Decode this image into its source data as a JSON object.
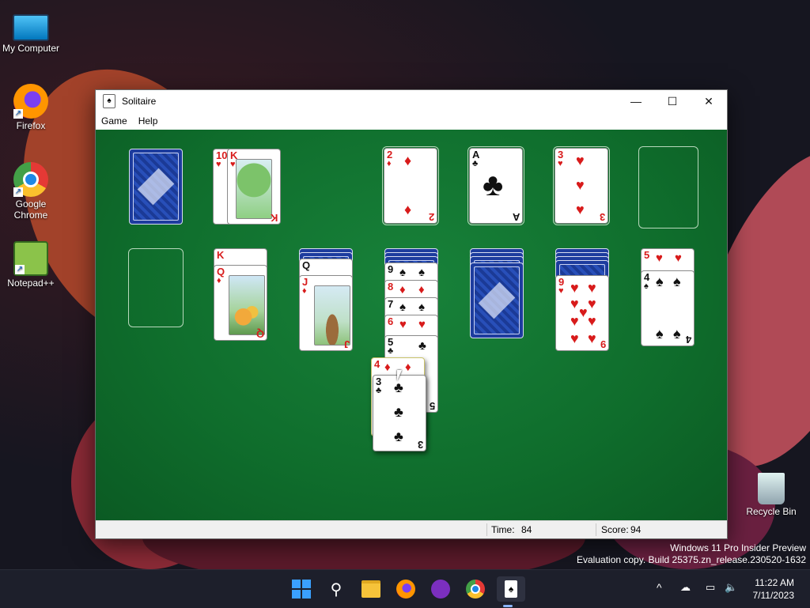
{
  "desktop": {
    "icons": [
      {
        "label": "My Computer",
        "icon": "computer-icon"
      },
      {
        "label": "Firefox",
        "icon": "firefox-icon"
      },
      {
        "label": "Google Chrome",
        "icon": "chrome-icon"
      },
      {
        "label": "Notepad++",
        "icon": "notepadpp-icon"
      },
      {
        "label": "Recycle Bin",
        "icon": "recycle-bin-icon"
      }
    ],
    "watermark": {
      "line1": "Windows 11 Pro Insider Preview",
      "line2": "Evaluation copy. Build 25375.zn_release.230520-1632"
    }
  },
  "window": {
    "title": "Solitaire",
    "controls": {
      "minimize": "—",
      "maximize": "☐",
      "close": "✕"
    },
    "menu": [
      "Game",
      "Help"
    ],
    "status": {
      "time_label": "Time:",
      "time_value": "84",
      "score_label": "Score:",
      "score_value": "94"
    }
  },
  "game": {
    "stock": "face-down",
    "waste": [
      "10♥",
      "K♥"
    ],
    "foundations": [
      "2♦",
      "A♣",
      "3♥",
      "empty"
    ],
    "tableau": [
      {
        "face_down": 0,
        "face_up": []
      },
      {
        "face_down": 0,
        "face_up": [
          "K♥",
          "Q♦"
        ]
      },
      {
        "face_down": 2,
        "face_up": [
          "Q♠",
          "J♦"
        ]
      },
      {
        "face_down": 3,
        "face_up": [
          "9♠",
          "8♦",
          "7♠",
          "6♥",
          "5♣"
        ]
      },
      {
        "face_down": 4,
        "face_up": []
      },
      {
        "face_down": 4,
        "face_up": [
          "9♥"
        ]
      },
      {
        "face_down": 0,
        "face_up": [
          "5♥",
          "4♠"
        ]
      }
    ],
    "dragging": [
      "4♦",
      "3♣"
    ],
    "card_text": {
      "ten": "10",
      "king": "K",
      "queen": "Q",
      "jack": "J",
      "nine": "9",
      "eight": "8",
      "seven": "7",
      "six": "6",
      "five": "5",
      "four": "4",
      "three": "3",
      "two": "2",
      "ace": "A",
      "heart": "♥",
      "diamond": "♦",
      "club": "♣",
      "spade": "♠"
    }
  },
  "taskbar": {
    "apps": [
      "start-icon",
      "search-icon",
      "file-explorer-icon",
      "firefox-icon",
      "app-icon",
      "chrome-icon",
      "solitaire-icon"
    ],
    "tray": {
      "chevron": "^"
    },
    "clock": {
      "time": "11:22 AM",
      "date": "7/11/2023"
    }
  }
}
